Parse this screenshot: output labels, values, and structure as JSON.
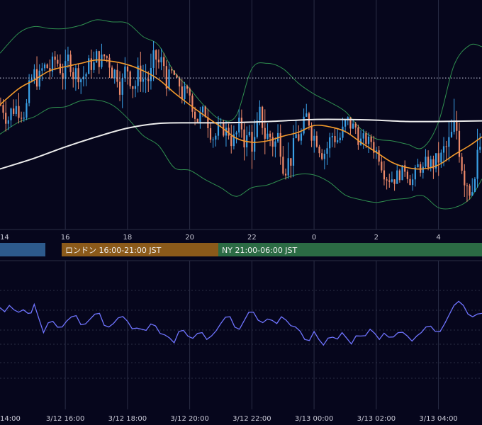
{
  "colors": {
    "background": "#06061c",
    "grid": "#2a2d45",
    "candle_up": "#3aa0e6",
    "candle_down": "#ee8a6a",
    "ma_short": "#f39a2b",
    "ma_long": "#ececec",
    "bollinger": "#2f8f4f",
    "oscillator": "#6f74ff",
    "baseline": "#cfd3e6",
    "session_tokyo": "#2d5a8c",
    "session_london": "#8b5a1a",
    "session_ny": "#2b6b44",
    "axis_text": "#c9c9d6"
  },
  "price_chart": {
    "type": "candlestick",
    "hour_axis_labels": [
      "14",
      "16",
      "18",
      "20",
      "22",
      "0",
      "2",
      "4"
    ],
    "dotted_reference_level": 216
  },
  "sessions": [
    {
      "label": "",
      "color": "session_tokyo"
    },
    {
      "label": "ロンドン 16:00-21:00 JST",
      "color": "session_london"
    },
    {
      "label": "NY 21:00-06:00 JST",
      "color": "session_ny"
    }
  ],
  "oscillator_panel": {
    "date_axis_labels": [
      "14:00",
      "3/12 16:00",
      "3/12 18:00",
      "3/12 20:00",
      "3/12 22:00",
      "3/13 00:00",
      "3/13 02:00",
      "3/13 04:00"
    ]
  },
  "chart_data": {
    "type": "line",
    "x_unit": "hours (JST, 3/12 14:00 to 3/13 05:00)",
    "x_range": [
      13.9,
      29.4
    ],
    "series": [
      {
        "key": "ma_long",
        "x": [
          13.9,
          15,
          16,
          17,
          18,
          19,
          20,
          21,
          22,
          23,
          24,
          25,
          26,
          27,
          28,
          29.4
        ],
        "y": [
          80,
          96,
          113,
          128,
          141,
          148,
          149,
          149,
          150,
          152,
          154,
          154,
          153,
          151,
          151,
          152
        ]
      },
      {
        "key": "ma_short",
        "x": [
          13.9,
          14.5,
          15,
          15.5,
          16,
          16.5,
          17,
          17.5,
          18,
          18.5,
          19,
          19.5,
          20,
          20.5,
          21,
          21.5,
          22,
          22.5,
          23,
          23.5,
          24,
          24.5,
          25,
          25.5,
          26,
          26.5,
          27,
          27.5,
          28,
          28.5,
          29,
          29.4
        ],
        "y": [
          176,
          200,
          213,
          227,
          233,
          238,
          243,
          241,
          236,
          227,
          214,
          194,
          176,
          159,
          143,
          126,
          120,
          122,
          129,
          135,
          145,
          143,
          136,
          120,
          105,
          90,
          82,
          80,
          86,
          101,
          115,
          128
        ]
      },
      {
        "key": "bb_upper",
        "x": [
          13.9,
          14.5,
          15,
          15.5,
          16,
          16.5,
          17,
          17.5,
          18,
          18.5,
          19,
          19.5,
          20,
          20.5,
          21,
          21.5,
          22,
          22.5,
          23,
          23.5,
          24,
          24.5,
          25,
          25.5,
          26,
          26.5,
          27,
          27.5,
          28,
          28.5,
          29,
          29.4
        ],
        "y": [
          253,
          283,
          293,
          290,
          290,
          295,
          303,
          300,
          298,
          278,
          265,
          225,
          200,
          173,
          154,
          160,
          230,
          238,
          230,
          208,
          192,
          180,
          166,
          140,
          125,
          122,
          117,
          112,
          150,
          235,
          265,
          263
        ]
      },
      {
        "key": "bb_lower",
        "x": [
          13.9,
          14.5,
          15,
          15.5,
          16,
          16.5,
          17,
          17.5,
          18,
          18.5,
          19,
          19.5,
          20,
          20.5,
          21,
          21.5,
          22,
          22.5,
          23,
          23.5,
          24,
          24.5,
          25,
          25.5,
          26,
          26.5,
          27,
          27.5,
          28,
          28.5,
          29,
          29.4
        ],
        "y": [
          132,
          150,
          158,
          171,
          173,
          182,
          183,
          176,
          156,
          130,
          115,
          82,
          78,
          64,
          52,
          39,
          52,
          56,
          65,
          72,
          71,
          60,
          41,
          34,
          30,
          34,
          36,
          40,
          22,
          22,
          35,
          65
        ]
      },
      {
        "key": "oscillator",
        "x": [
          13.9,
          14.2,
          14.5,
          14.8,
          15.0,
          15.3,
          15.6,
          15.9,
          16.2,
          16.5,
          16.8,
          17.1,
          17.4,
          17.7,
          18.0,
          18.3,
          18.6,
          18.9,
          19.2,
          19.5,
          19.8,
          20.1,
          20.4,
          20.7,
          21.0,
          21.3,
          21.6,
          21.9,
          22.2,
          22.5,
          22.8,
          23.1,
          23.4,
          23.7,
          24.0,
          24.3,
          24.6,
          24.9,
          25.2,
          25.5,
          25.8,
          26.1,
          26.4,
          26.7,
          27.0,
          27.3,
          27.6,
          27.9,
          28.2,
          28.5,
          28.8,
          29.1,
          29.4
        ],
        "y": [
          66,
          68,
          62,
          61,
          69,
          44,
          54,
          49,
          58,
          51,
          56,
          61,
          49,
          57,
          54,
          48,
          46,
          50,
          42,
          35,
          46,
          39,
          44,
          41,
          52,
          58,
          47,
          62,
          55,
          56,
          52,
          55,
          49,
          38,
          45,
          33,
          40,
          44,
          34,
          41,
          47,
          38,
          40,
          44,
          41,
          41,
          49,
          45,
          52,
          68,
          68,
          58,
          61
        ]
      }
    ]
  }
}
